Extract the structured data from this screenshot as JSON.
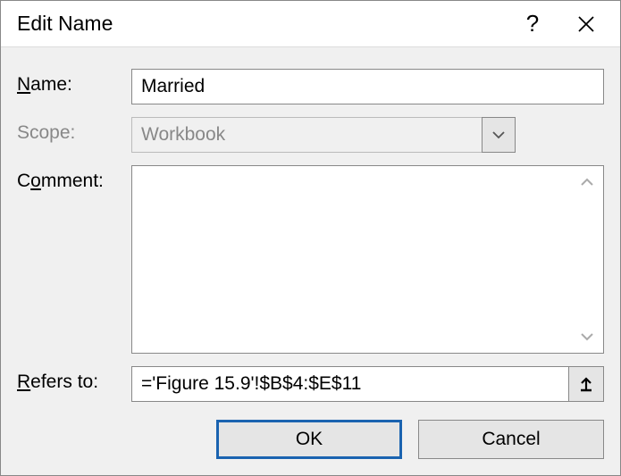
{
  "title": "Edit Name",
  "labels": {
    "name": "ame:",
    "scope": "Scope:",
    "comment": "mment:",
    "refers": "efers to:"
  },
  "fields": {
    "name_value": "Married",
    "scope_value": "Workbook",
    "comment_value": "",
    "refers_value": "='Figure 15.9'!$B$4:$E$11"
  },
  "buttons": {
    "ok": "OK",
    "cancel": "Cancel"
  }
}
